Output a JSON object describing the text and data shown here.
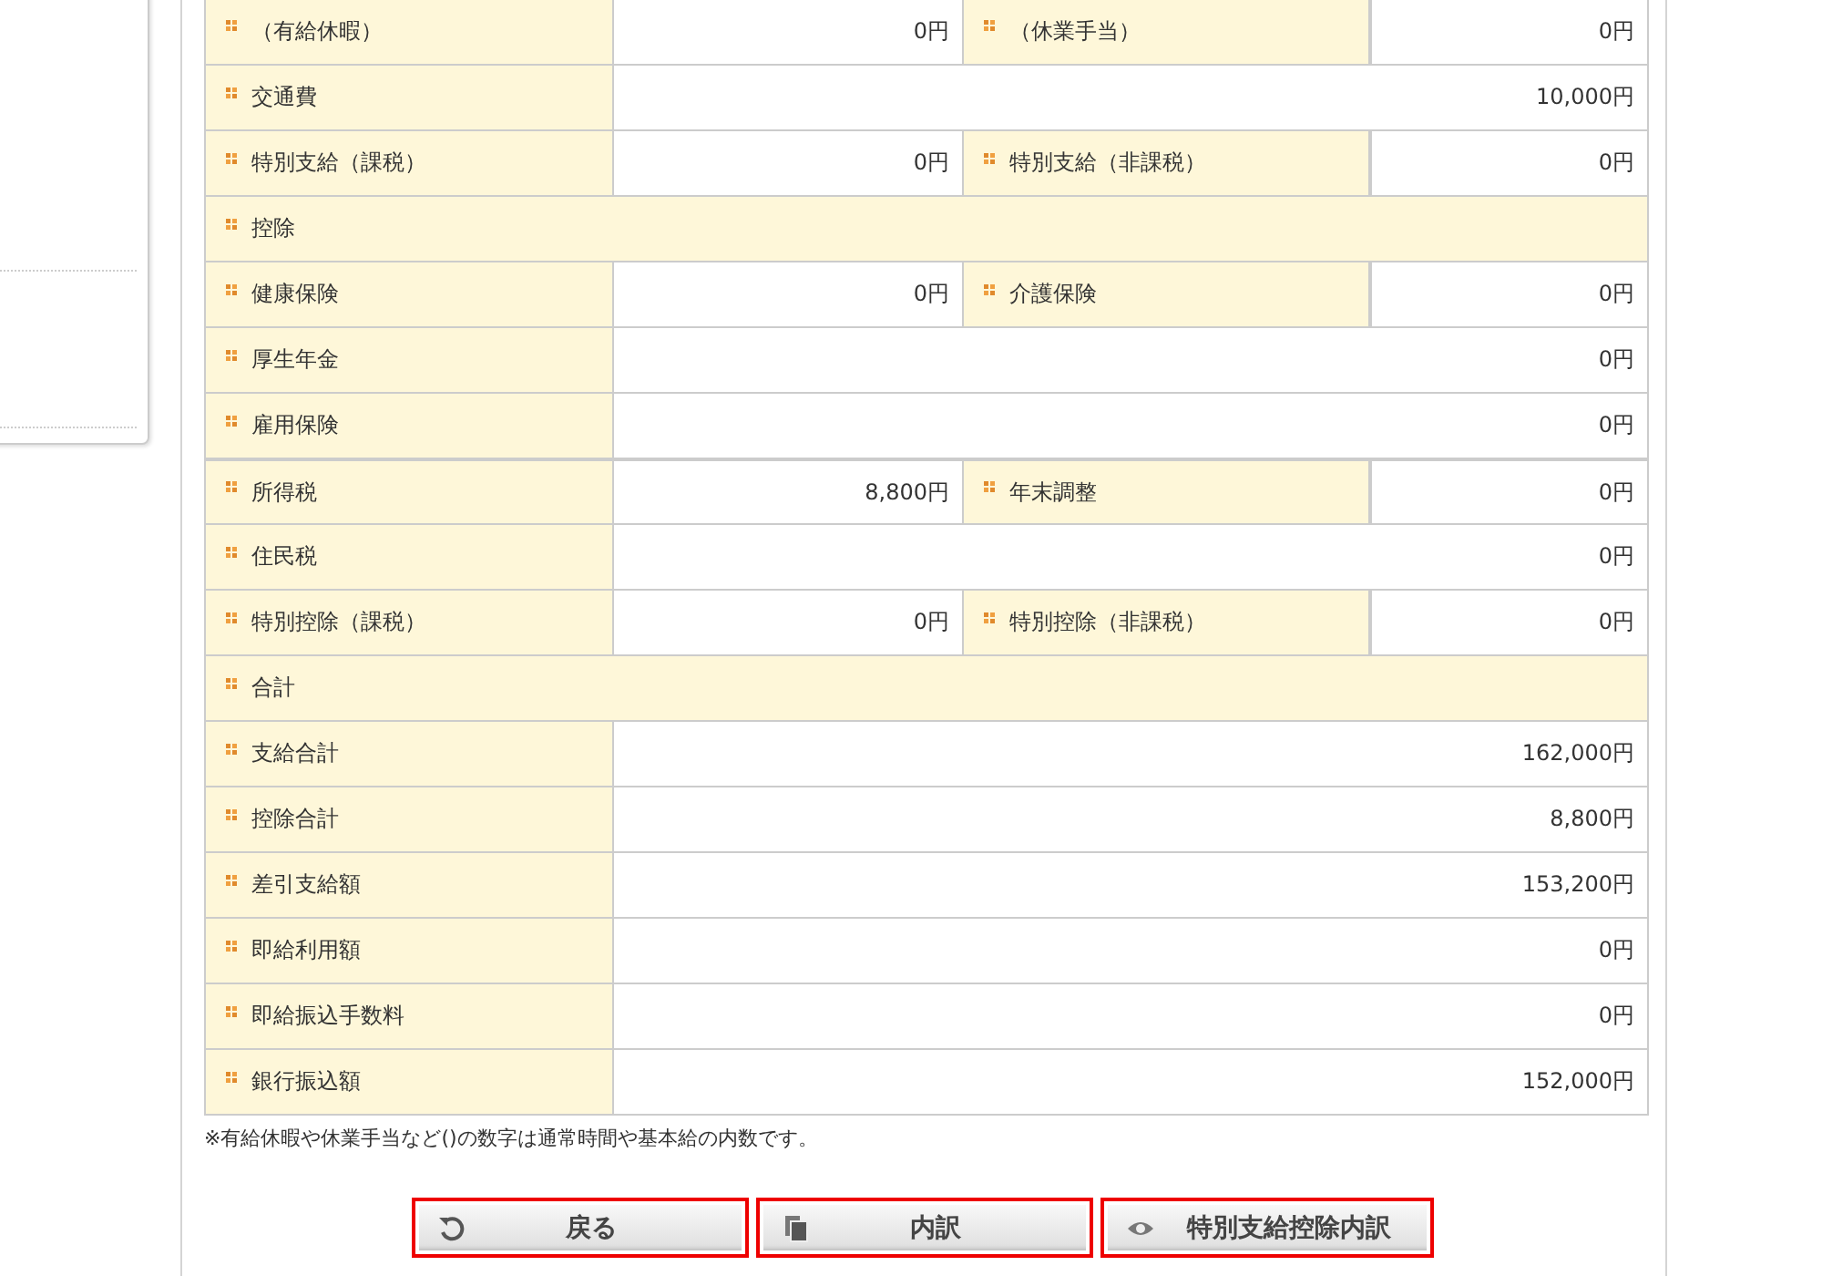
{
  "rows": [
    {
      "kind": "pair",
      "label": "（有給休暇）",
      "value": "0円",
      "label2": "（休業手当）",
      "value2": "0円"
    },
    {
      "kind": "single",
      "label": "交通費",
      "value": "10,000円"
    },
    {
      "kind": "pair",
      "label": "特別支給（課税）",
      "value": "0円",
      "label2": "特別支給（非課税）",
      "value2": "0円"
    },
    {
      "kind": "section",
      "label": "控除"
    },
    {
      "kind": "pair",
      "label": "健康保険",
      "value": "0円",
      "label2": "介護保険",
      "value2": "0円"
    },
    {
      "kind": "single",
      "label": "厚生年金",
      "value": "0円"
    },
    {
      "kind": "single",
      "label": "雇用保険",
      "value": "0円"
    },
    {
      "kind": "pair",
      "label": "所得税",
      "value": "8,800円",
      "label2": "年末調整",
      "value2": "0円"
    },
    {
      "kind": "single",
      "label": "住民税",
      "value": "0円"
    },
    {
      "kind": "pair",
      "label": "特別控除（課税）",
      "value": "0円",
      "label2": "特別控除（非課税）",
      "value2": "0円"
    },
    {
      "kind": "section",
      "label": "合計"
    },
    {
      "kind": "single",
      "label": "支給合計",
      "value": "162,000円"
    },
    {
      "kind": "single",
      "label": "控除合計",
      "value": "8,800円"
    },
    {
      "kind": "single",
      "label": "差引支給額",
      "value": "153,200円"
    },
    {
      "kind": "single",
      "label": "即給利用額",
      "value": "0円"
    },
    {
      "kind": "single",
      "label": "即給振込手数料",
      "value": "0円"
    },
    {
      "kind": "single",
      "label": "銀行振込額",
      "value": "152,000円"
    }
  ],
  "note": "※有給休暇や休業手当など()の数字は通常時間や基本給の内数です。",
  "buttons": [
    {
      "kind": "back",
      "label": "戻る"
    },
    {
      "kind": "copy",
      "label": "内訳"
    },
    {
      "kind": "view",
      "label": "特別支給控除内訳"
    }
  ]
}
